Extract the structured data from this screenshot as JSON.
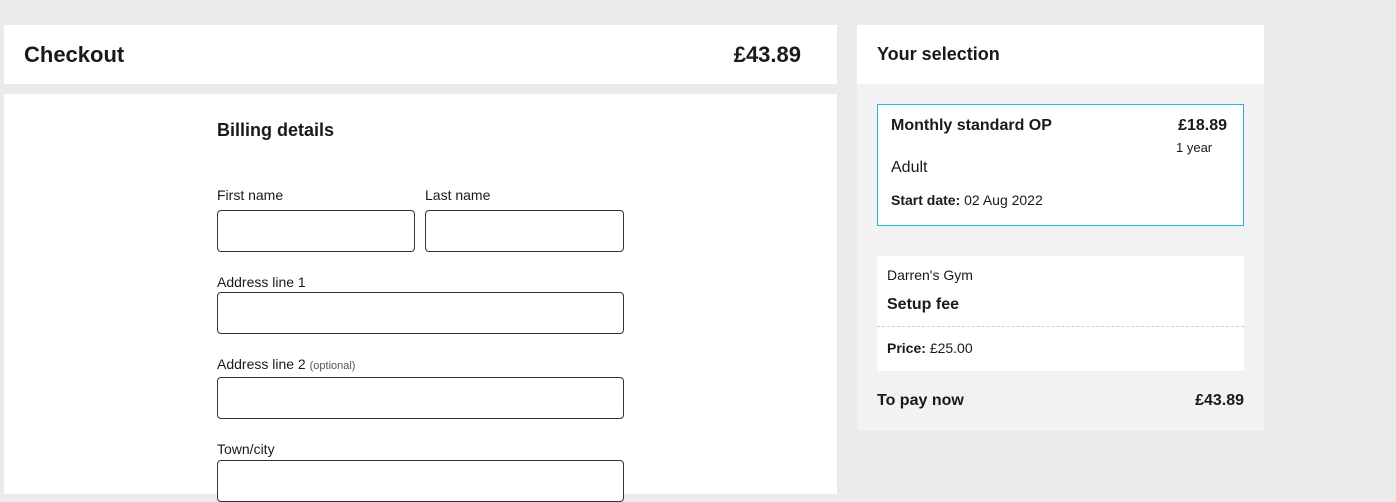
{
  "header": {
    "title": "Checkout",
    "total": "£43.89"
  },
  "billing": {
    "title": "Billing details",
    "first_name": {
      "label": "First name",
      "value": ""
    },
    "last_name": {
      "label": "Last name",
      "value": ""
    },
    "address1": {
      "label": "Address line 1",
      "value": ""
    },
    "address2": {
      "label": "Address line 2",
      "optional": "(optional)",
      "value": ""
    },
    "town": {
      "label": "Town/city",
      "value": ""
    }
  },
  "summary": {
    "title": "Your selection",
    "plan": {
      "name": "Monthly standard OP",
      "price": "£18.89",
      "term": "1 year",
      "type": "Adult",
      "start_label": "Start date:",
      "start_value": "02 Aug 2022"
    },
    "fee": {
      "gym": "Darren's Gym",
      "name": "Setup fee",
      "price_label": "Price:",
      "price_value": "£25.00"
    },
    "to_pay_label": "To pay now",
    "to_pay_amount": "£43.89"
  },
  "colors": {
    "accent": "#1fb7c9",
    "page_bg": "#ebebeb",
    "summary_bg": "#f2f2f2"
  }
}
